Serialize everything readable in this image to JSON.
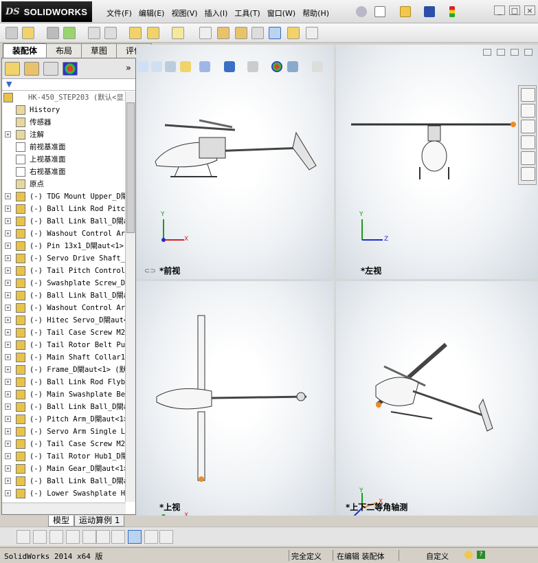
{
  "app": {
    "brand_ds": "DS",
    "brand_name": "SOLIDWORKS"
  },
  "menu": [
    "文件(F)",
    "编辑(E)",
    "视图(V)",
    "插入(I)",
    "工具(T)",
    "窗口(W)",
    "帮助(H)"
  ],
  "tabs": [
    "装配体",
    "布局",
    "草图",
    "评估"
  ],
  "tree": {
    "root": "HK-450_STEP203 (默认<显",
    "fixed": [
      "History",
      "传感器",
      "注解",
      "前视基准面",
      "上视基准面",
      "右视基准面",
      "原点"
    ],
    "parts": [
      "(-) TDG Mount Upper_D閘ut",
      "(-) Ball Link Rod Pitch",
      "(-) Ball Link Ball_D閘a",
      "(-) Washout Control Arm",
      "(-) Pin 13x1_D閘aut<1>",
      "(-) Servo Drive Shaft_D",
      "(-) Tail Pitch Control_",
      "(-) Swashplate Screw_D閘",
      "(-) Ball Link Ball_D閘a",
      "(-) Washout Control Arm",
      "(-) Hitec Servo_D閘aut<",
      "(-) Tail Case Screw M2x",
      "(-) Tail Rotor Belt Pul",
      "(-) Main Shaft Collar1_",
      "(-) Frame_D閘aut<1> (默",
      "(-) Ball Link Rod Flyba",
      "(-) Main Swashplate Bea",
      "(-) Ball Link Ball_D閘a",
      "(-) Pitch Arm_D閘aut<1>",
      "(-) Servo Arm Single Lo",
      "(-) Tail Case Screw M2x",
      "(-) Tail Rotor Hub1_D閘",
      "(-) Main Gear_D閘aut<1>",
      "(-) Ball Link Ball_D閘a",
      "(-) Lower Swashplate Ho"
    ]
  },
  "bottom_tabs": [
    "模型",
    "运动算例 1"
  ],
  "views": {
    "front": "*前视",
    "left": "*左视",
    "top": "*上视",
    "iso": "*上下二等角轴测"
  },
  "axes": {
    "x": "X",
    "y": "Y",
    "z": "Z"
  },
  "status": {
    "version": "SolidWorks 2014 x64 版",
    "defined": "完全定义",
    "editing": "在编辑 装配体",
    "custom": "自定义"
  },
  "colors": {
    "accent": "#316ac5",
    "heli_orange": "#f08a24",
    "axis_red": "#d32020",
    "axis_green": "#1a9a1a",
    "axis_blue": "#1d2fc9"
  }
}
